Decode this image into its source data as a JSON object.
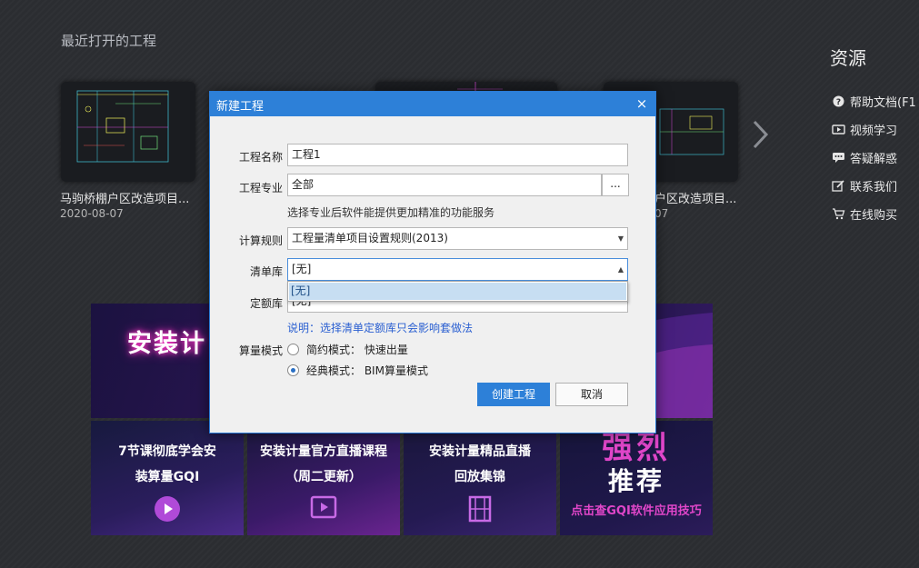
{
  "recent": {
    "title": "最近打开的工程",
    "projects": [
      {
        "name": "马驹桥棚户区改造项目...",
        "date": "2020-08-07"
      },
      {
        "name": "户区改造项目...",
        "date": "07"
      }
    ]
  },
  "resources": {
    "title": "资源",
    "items": [
      {
        "label": "帮助文档(F1",
        "icon": "help-icon"
      },
      {
        "label": "视频学习",
        "icon": "video-icon"
      },
      {
        "label": "答疑解惑",
        "icon": "chat-icon"
      },
      {
        "label": "联系我们",
        "icon": "edit-icon"
      },
      {
        "label": "在线购买",
        "icon": "cart-icon"
      }
    ]
  },
  "banners": {
    "top_text": "安装计",
    "tiles": [
      {
        "line1": "7节课彻底学会安",
        "line2": "装算量GQI"
      },
      {
        "line1": "安装计量官方直播课程",
        "line2": "（周二更新）"
      },
      {
        "line1": "安装计量精品直播",
        "line2": "回放集锦"
      },
      {
        "big1": "强烈",
        "big2": "推荐",
        "sub": "点击查GQI软件应用技巧"
      }
    ]
  },
  "dialog": {
    "title": "新建工程",
    "close": "×",
    "name_label": "工程名称",
    "name_value": "工程1",
    "major_label": "工程专业",
    "major_value": "全部",
    "major_button": "...",
    "major_hint": "选择专业后软件能提供更加精准的功能服务",
    "rule_label": "计算规则",
    "rule_value": "工程量清单项目设置规则(2013)",
    "list_label": "清单库",
    "list_value": "[无]",
    "list_option": "[无]",
    "quota_label": "定额库",
    "quota_value": "[无]",
    "quota_hint": "说明：选择清单定额库只会影响套做法",
    "mode_label": "算量模式",
    "mode_simple": "简约模式：  快速出量",
    "mode_classic": "经典模式：  BIM算量模式",
    "create_button": "创建工程",
    "cancel_button": "取消"
  }
}
